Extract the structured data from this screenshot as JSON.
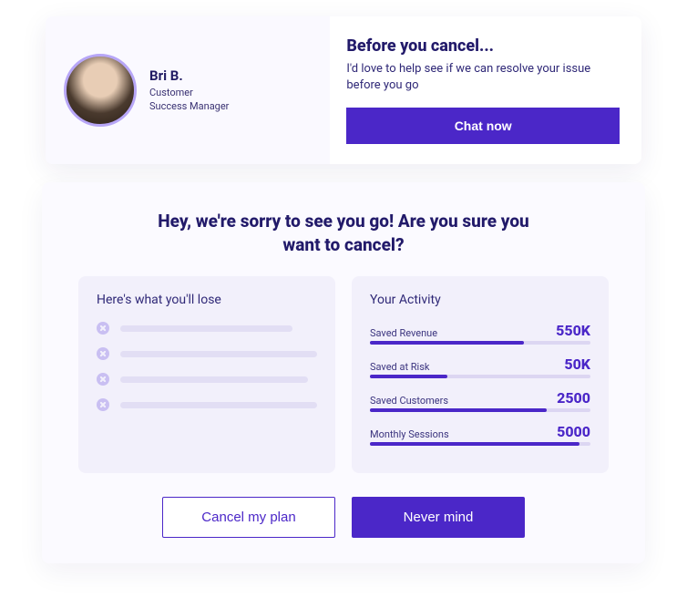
{
  "person": {
    "name": "Bri B.",
    "role": "Customer\nSuccess Manager"
  },
  "message": {
    "title": "Before you cancel...",
    "body": "I'd love to help see if we can resolve your issue before you go",
    "cta": "Chat now"
  },
  "modal": {
    "title": "Hey, we're sorry to see you go! Are you sure you want to cancel?",
    "lose": {
      "title": "Here's what you'll lose",
      "items": [
        {
          "width": "78%"
        },
        {
          "width": "90%"
        },
        {
          "width": "85%"
        },
        {
          "width": "95%"
        }
      ]
    },
    "activity": {
      "title": "Your Activity",
      "metrics": [
        {
          "label": "Saved Revenue",
          "value": "550K",
          "fill": "70%"
        },
        {
          "label": "Saved at Risk",
          "value": "50K",
          "fill": "35%"
        },
        {
          "label": "Saved Customers",
          "value": "2500",
          "fill": "80%"
        },
        {
          "label": "Monthly Sessions",
          "value": "5000",
          "fill": "95%"
        }
      ]
    },
    "actions": {
      "cancel": "Cancel my plan",
      "keep": "Never mind"
    }
  }
}
